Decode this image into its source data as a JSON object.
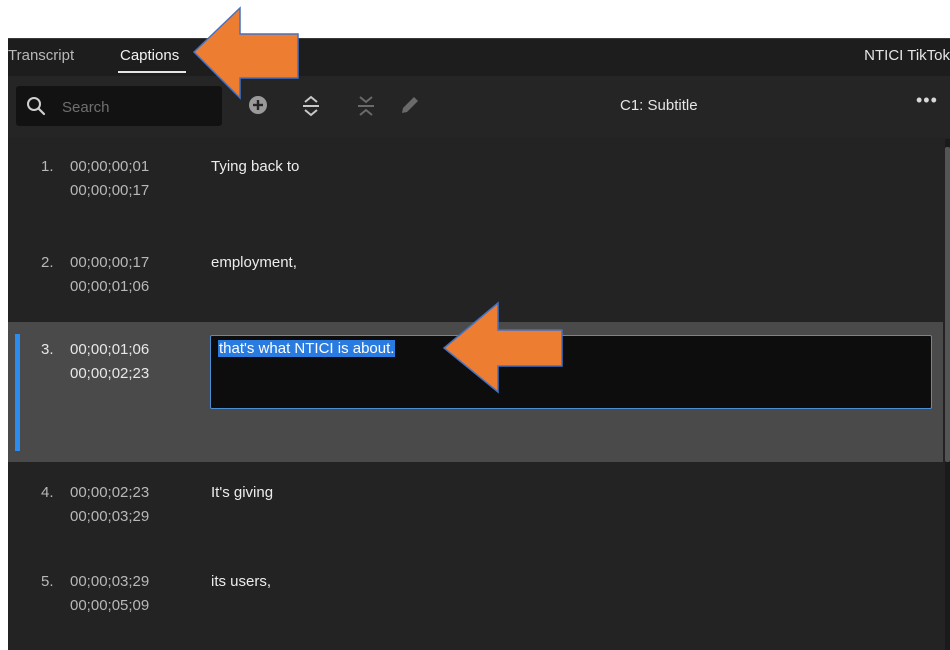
{
  "tabs": {
    "transcript": "Transcript",
    "captions": "Captions"
  },
  "project_title": "NTICI TikTok",
  "search": {
    "placeholder": "Search",
    "value": ""
  },
  "toolbar": {
    "track_label": "C1: Subtitle",
    "more_label": "•••",
    "icons": [
      "add-icon",
      "expand-icon",
      "collapse-icon",
      "pencil-icon"
    ]
  },
  "captions": [
    {
      "index": "1.",
      "in": "00;00;00;01",
      "out": "00;00;00;17",
      "text": "Tying back to"
    },
    {
      "index": "2.",
      "in": "00;00;00;17",
      "out": "00;00;01;06",
      "text": "employment,"
    },
    {
      "index": "3.",
      "in": "00;00;01;06",
      "out": "00;00;02;23",
      "text": "that's what NTICI is about."
    },
    {
      "index": "4.",
      "in": "00;00;02;23",
      "out": "00;00;03;29",
      "text": "It's giving"
    },
    {
      "index": "5.",
      "in": "00;00;03;29",
      "out": "00;00;05;09",
      "text": "its users,"
    }
  ],
  "colors": {
    "accent": "#2d8cf0",
    "selection": "#2a7be0",
    "annotation_arrow": "#ed7d31",
    "annotation_arrow_border": "#4472c4"
  }
}
